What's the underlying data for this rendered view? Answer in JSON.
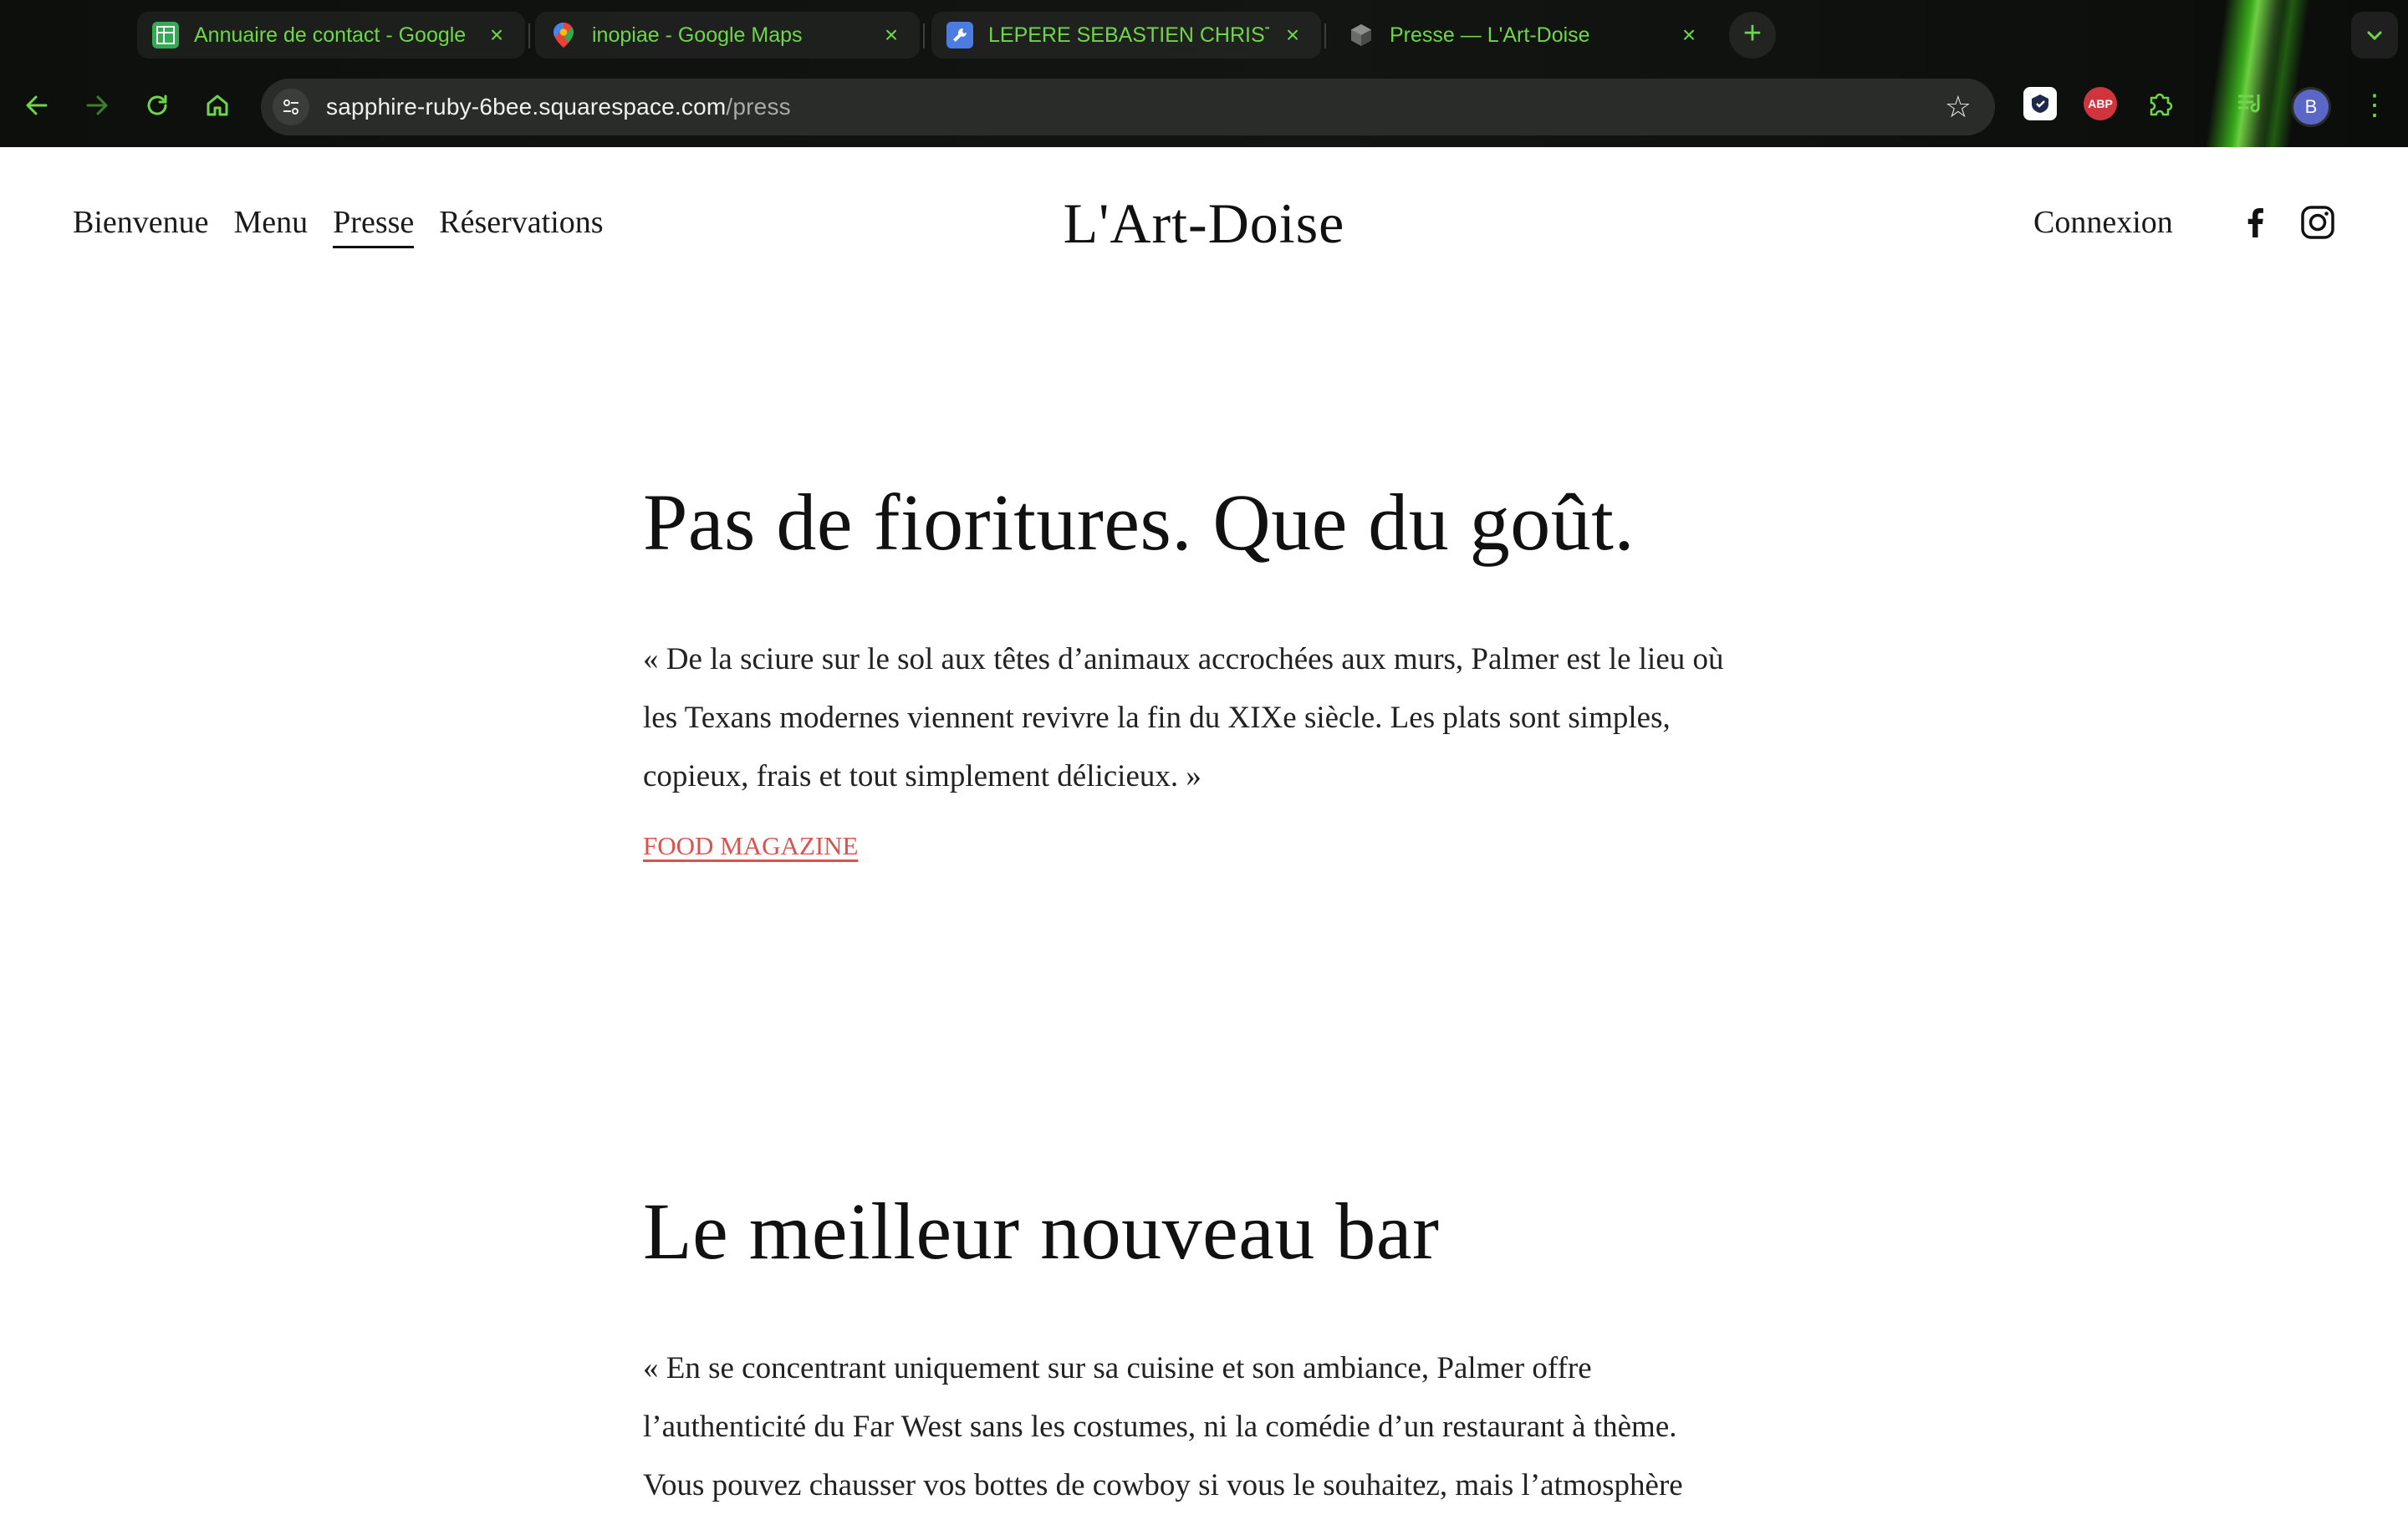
{
  "browser": {
    "tabs": [
      {
        "title": "Annuaire de contact - Google",
        "favicon": "sheets-icon",
        "color": "#34a853"
      },
      {
        "title": "inopiae - Google Maps",
        "favicon": "maps-pin-icon",
        "color": "#ea4335"
      },
      {
        "title": "LEPERE SEBASTIEN CHRISTIAN",
        "favicon": "wrench-icon",
        "color": "#4c7ce0"
      },
      {
        "title": "Presse — L'Art-Doise",
        "favicon": "squarespace-cube-icon",
        "color": "#555555",
        "active": true
      }
    ],
    "address_bar": {
      "host": "sapphire-ruby-6bee.squarespace.com",
      "path": "/press"
    },
    "extensions": [
      {
        "name": "extension-shield-icon",
        "label": ""
      },
      {
        "name": "adblock-plus-icon",
        "label": "ABP"
      },
      {
        "name": "puzzle-extensions-icon",
        "label": ""
      },
      {
        "name": "media-controls-icon",
        "label": ""
      }
    ],
    "profile_initial": "B",
    "accent_color": "#6fd64a"
  },
  "site": {
    "nav": [
      {
        "label": "Bienvenue",
        "active": false
      },
      {
        "label": "Menu",
        "active": false
      },
      {
        "label": "Presse",
        "active": true
      },
      {
        "label": "Réservations",
        "active": false
      }
    ],
    "logo": "L'Art-Doise",
    "login": "Connexion",
    "social": [
      "facebook-icon",
      "instagram-icon"
    ],
    "articles": [
      {
        "heading": "Pas de fioritures. Que du goût.",
        "quote_lines": [
          "« De la sciure sur le sol aux têtes d’animaux accrochées aux murs, Palmer est le lieu où",
          "les Texans modernes viennent revivre la fin du XIXe siècle. Les plats sont simples,",
          "copieux, frais et tout simplement délicieux. »"
        ],
        "source": "FOOD MAGAZINE"
      },
      {
        "heading": "Le meilleur nouveau bar",
        "quote_lines": [
          "« En se concentrant uniquement sur sa cuisine et son ambiance, Palmer offre",
          "l’authenticité du Far West sans les costumes, ni la comédie d’un restaurant à thème.",
          "Vous pouvez chausser vos bottes de cowboy si vous le souhaitez, mais l’atmosphère"
        ]
      }
    ],
    "link_color": "#d9534f"
  }
}
